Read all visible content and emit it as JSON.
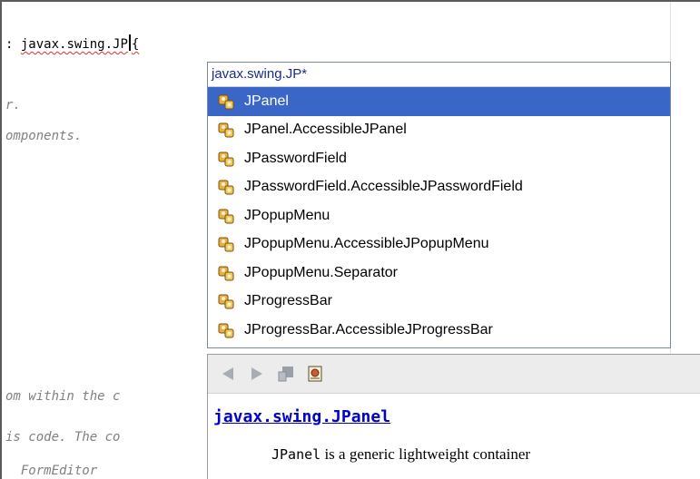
{
  "editor": {
    "code_line": "javax.swing.JP",
    "code_prefix": ":",
    "code_suffix": "{",
    "line_r": "r.",
    "line_components": "omponents.",
    "line_from_within": "om within the c",
    "line_this_code": "is code. The co",
    "line_formeditor": "  FormEditor"
  },
  "completion": {
    "header": "javax.swing.JP*",
    "items": [
      {
        "label": "JPanel",
        "icon": "class-icon",
        "selected": true
      },
      {
        "label": "JPanel.AccessibleJPanel",
        "icon": "class-icon"
      },
      {
        "label": "JPasswordField",
        "icon": "class-icon"
      },
      {
        "label": "JPasswordField.AccessibleJPasswordField",
        "icon": "class-icon"
      },
      {
        "label": "JPopupMenu",
        "icon": "class-icon"
      },
      {
        "label": "JPopupMenu.AccessibleJPopupMenu",
        "icon": "class-icon"
      },
      {
        "label": "JPopupMenu.Separator",
        "icon": "class-icon"
      },
      {
        "label": "JProgressBar",
        "icon": "class-icon"
      },
      {
        "label": "JProgressBar.AccessibleJProgressBar",
        "icon": "class-icon"
      }
    ]
  },
  "javadoc": {
    "toolbar": [
      "back-icon",
      "forward-icon",
      "go-to-source-icon",
      "open-in-browser-icon"
    ],
    "title": "javax.swing.JPanel",
    "body_code": "JPanel",
    "body_text": " is a generic lightweight container"
  },
  "colors": {
    "selection": "#3a66c8",
    "link": "#0000cc",
    "comment": "#808080"
  }
}
